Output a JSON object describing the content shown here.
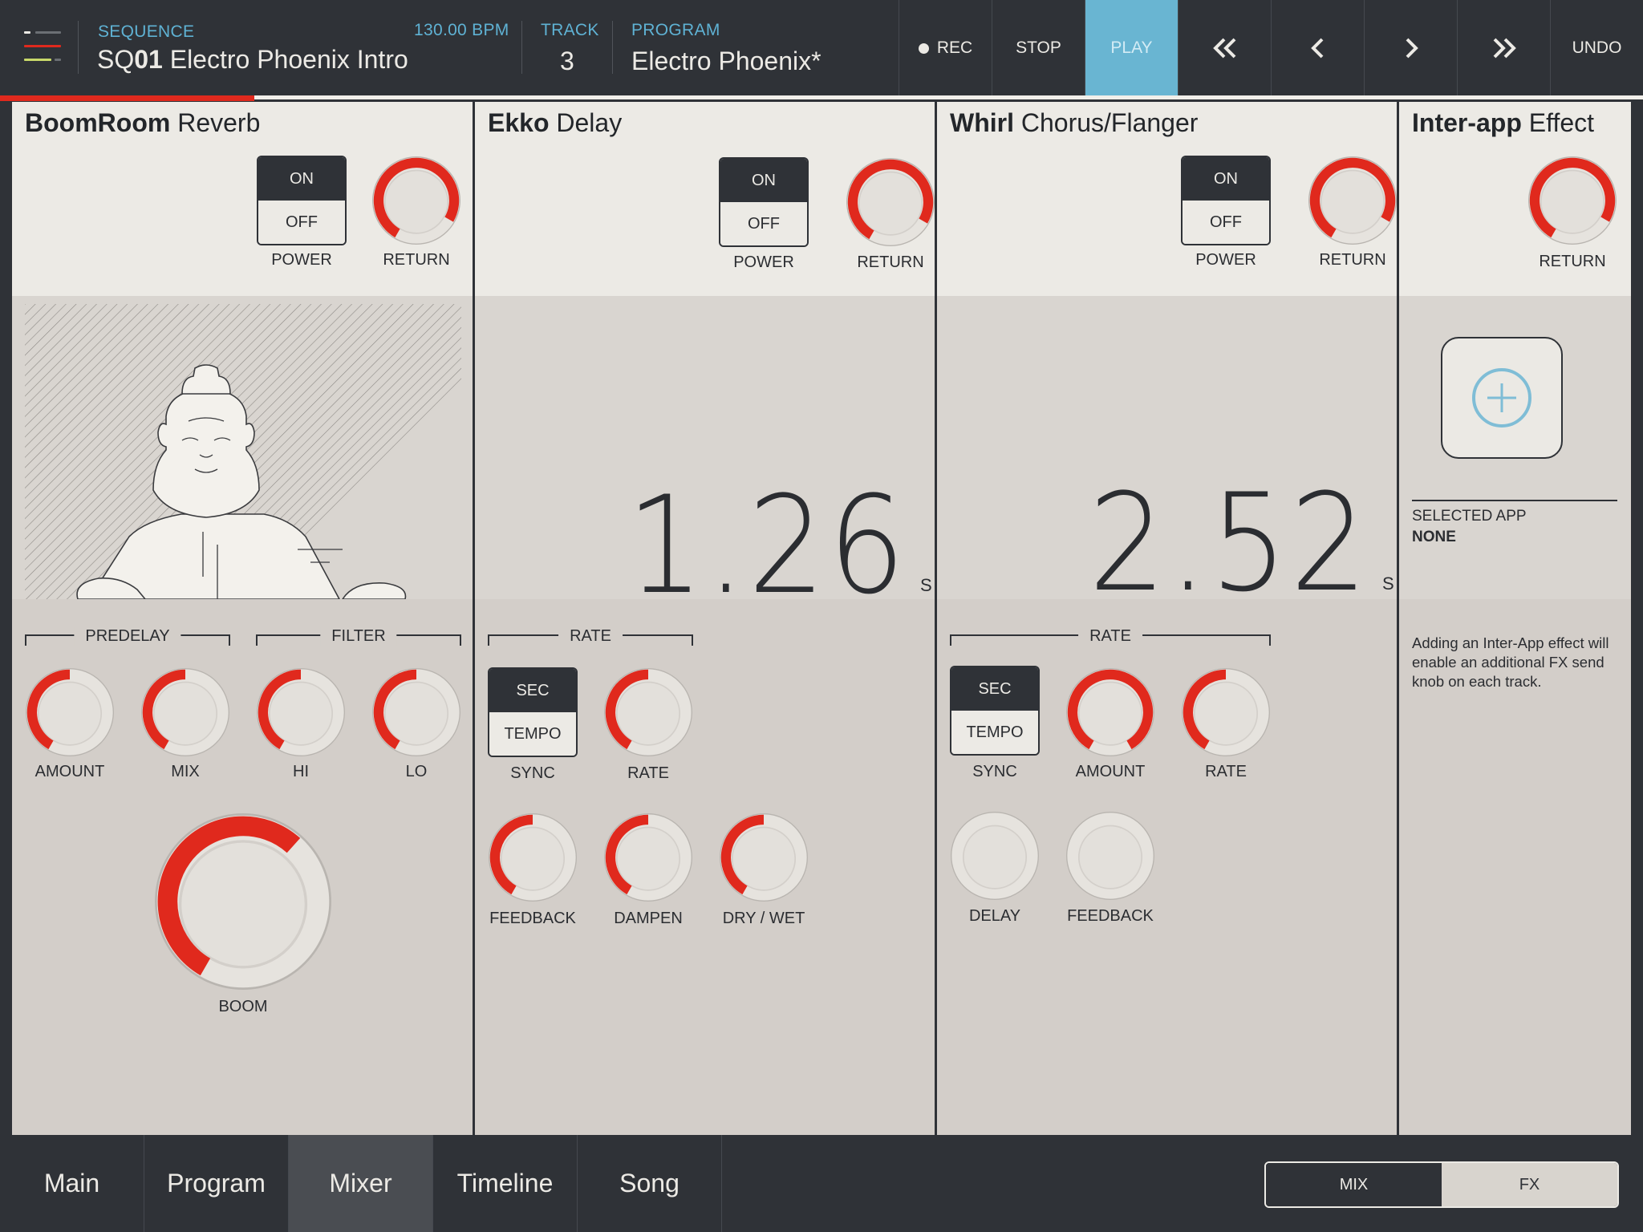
{
  "colors": {
    "accent_red": "#e0291d",
    "play_blue": "#69b5d2",
    "label_blue": "#5fb2d4",
    "dark": "#2f3237",
    "panel_light": "#eceae5"
  },
  "header": {
    "sequence_label": "SEQUENCE",
    "sequence_prefix": "SQ",
    "sequence_number": "01",
    "sequence_name": "Electro Phoenix Intro",
    "bpm": "130.00 BPM",
    "track_label": "TRACK",
    "track_value": "3",
    "program_label": "PROGRAM",
    "program_value": "Electro Phoenix*",
    "rec_label": "REC",
    "stop_label": "STOP",
    "play_label": "PLAY",
    "undo_label": "UNDO",
    "icons": {
      "menu": "hamburger-menu-icon",
      "rewind": "double-chevron-left-icon",
      "prev": "chevron-left-icon",
      "next": "chevron-right-icon",
      "ffwd": "double-chevron-right-icon"
    },
    "progress_fraction": 0.155
  },
  "reverb": {
    "title_bold": "BoomRoom",
    "title_rest": " Reverb",
    "toggle_on": "ON",
    "toggle_off": "OFF",
    "toggle_state": "on",
    "power_label": "POWER",
    "return_label": "RETURN",
    "return_value": 0.9,
    "predelay_label": "PREDELAY",
    "filter_label": "FILTER",
    "amount_label": "AMOUNT",
    "amount_value": 0.5,
    "mix_label": "MIX",
    "mix_value": 0.5,
    "hi_label": "HI",
    "hi_value": 0.5,
    "lo_label": "LO",
    "lo_value": 0.5,
    "boom_label": "BOOM",
    "boom_value": 0.64,
    "illustration": "buddha-statue-illustration"
  },
  "delay": {
    "title_bold": "Ekko",
    "title_rest": " Delay",
    "toggle_on": "ON",
    "toggle_off": "OFF",
    "toggle_state": "on",
    "power_label": "POWER",
    "return_label": "RETURN",
    "return_value": 0.9,
    "time_display": "1.26",
    "time_unit": "S",
    "rate_group_label": "RATE",
    "sync_sec": "SEC",
    "sync_tempo": "TEMPO",
    "sync_state": "sec",
    "sync_label": "SYNC",
    "rate_label": "RATE",
    "rate_value": 0.5,
    "feedback_label": "FEEDBACK",
    "feedback_value": 0.5,
    "dampen_label": "DAMPEN",
    "dampen_value": 0.5,
    "drywet_label": "DRY / WET",
    "drywet_value": 0.5
  },
  "chorus": {
    "title_bold": "Whirl",
    "title_rest": " Chorus/Flanger",
    "toggle_on": "ON",
    "toggle_off": "OFF",
    "toggle_state": "on",
    "power_label": "POWER",
    "return_label": "RETURN",
    "return_value": 0.9,
    "time_display": "2.52",
    "time_unit": "S",
    "rate_group_label": "RATE",
    "sync_sec": "SEC",
    "sync_tempo": "TEMPO",
    "sync_state": "sec",
    "sync_label": "SYNC",
    "amount_label": "AMOUNT",
    "amount_value": 1.0,
    "rate_label": "RATE",
    "rate_value": 0.5,
    "delay_label": "DELAY",
    "delay_value": 0,
    "feedback_label": "FEEDBACK",
    "feedback_value": 0
  },
  "interapp": {
    "title_bold": "Inter-app",
    "title_rest": " Effect",
    "return_label": "RETURN",
    "return_value": 0.9,
    "add_icon": "plus-circle-icon",
    "selected_app_label": "SELECTED APP",
    "selected_app_value": "NONE",
    "description": "Adding an Inter-App effect will enable an additional FX send knob on each track."
  },
  "bottom_tabs": [
    "Main",
    "Program",
    "Mixer",
    "Timeline",
    "Song"
  ],
  "active_tab": "Mixer",
  "view_toggle": {
    "mix": "MIX",
    "fx": "FX",
    "active": "FX"
  }
}
